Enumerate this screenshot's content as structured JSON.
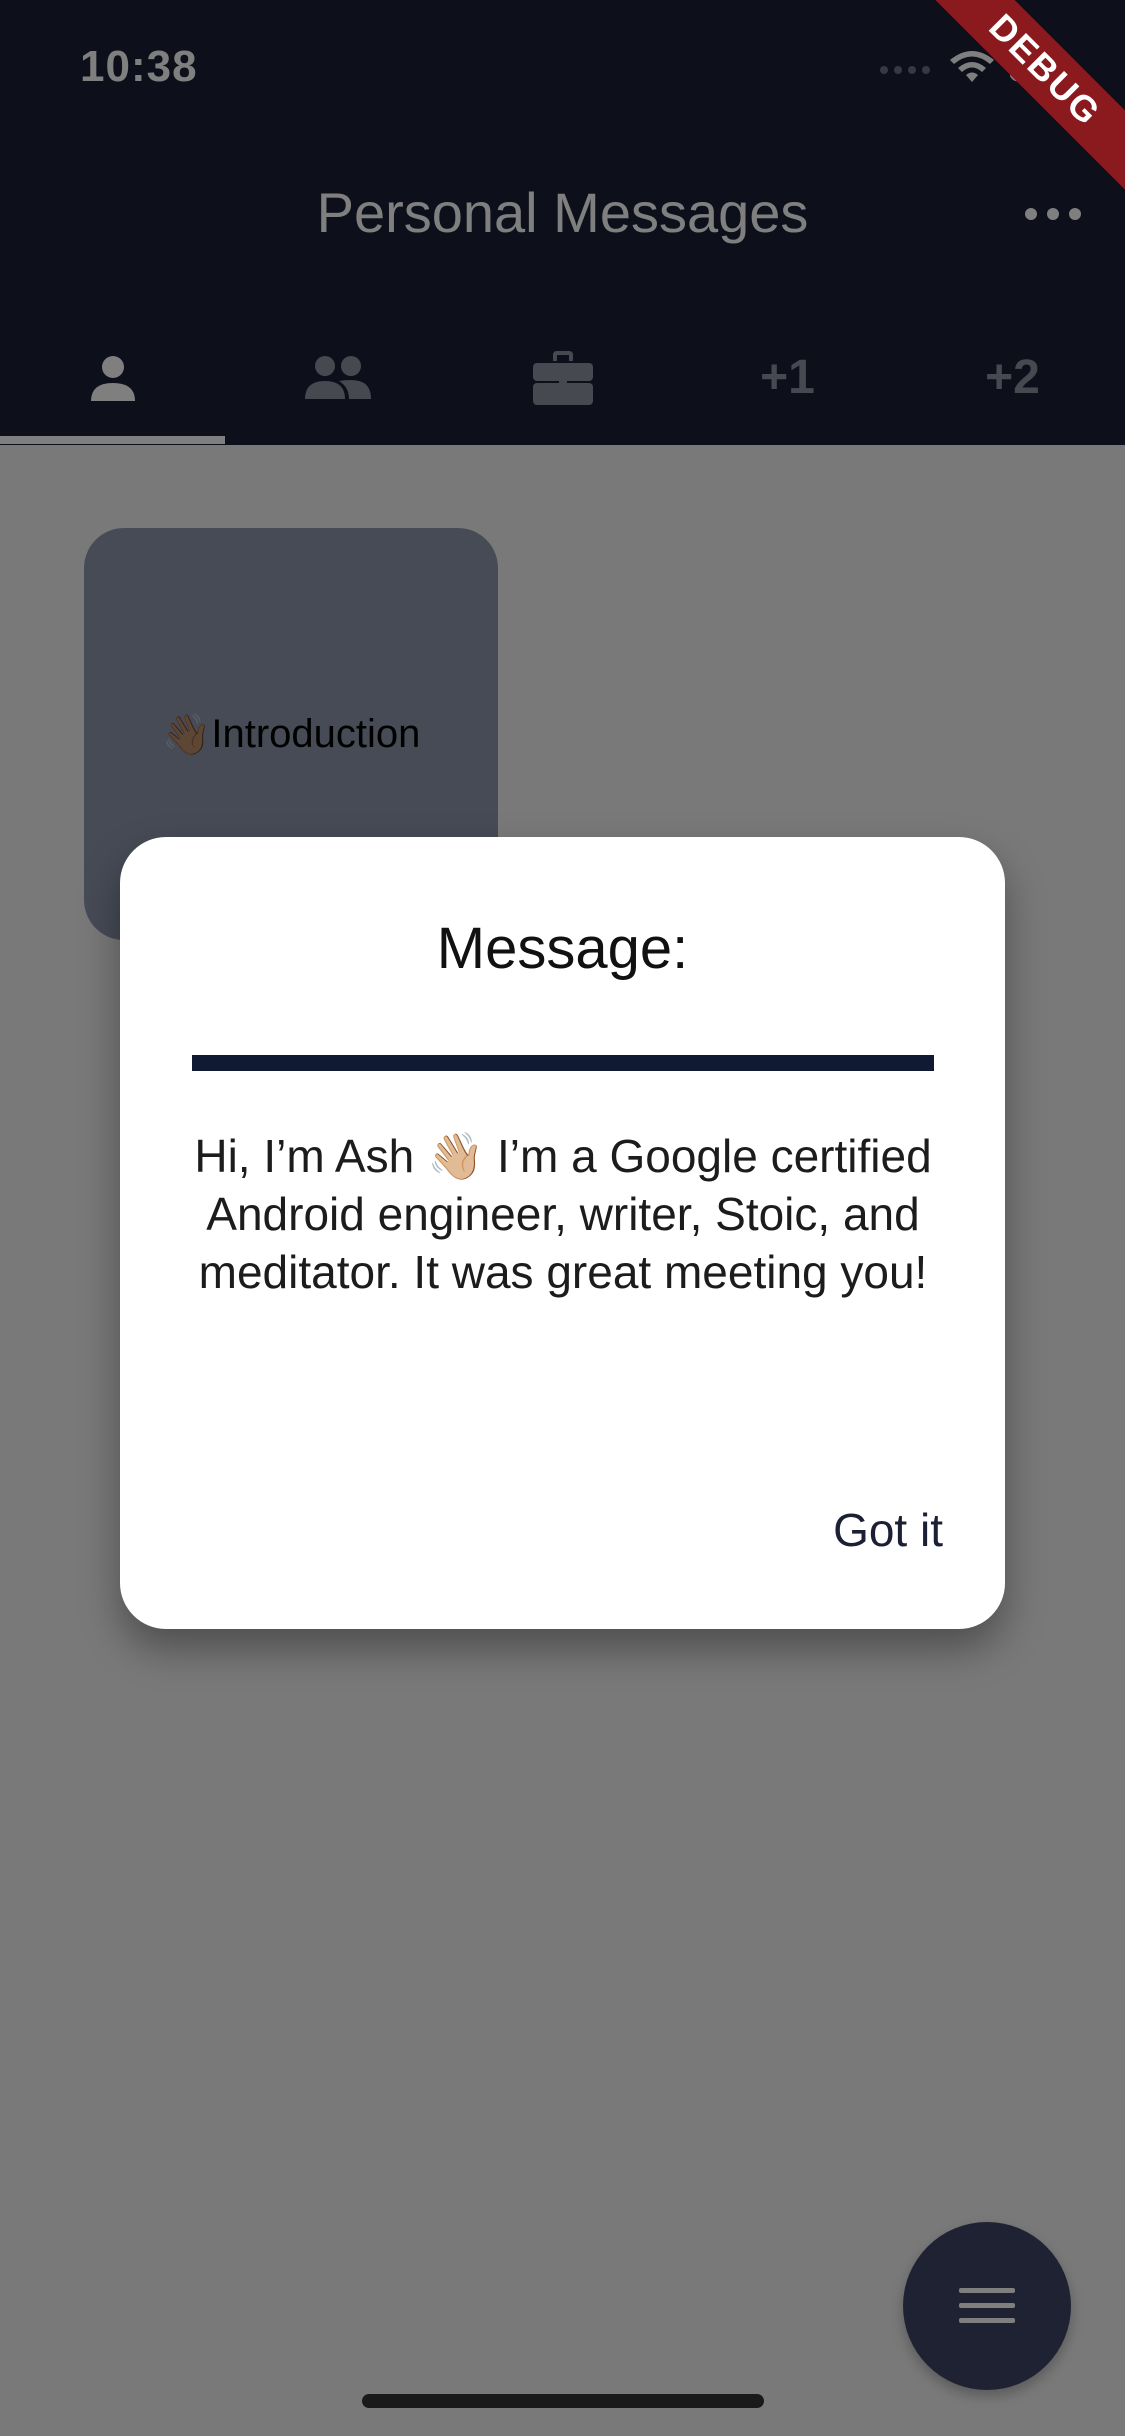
{
  "status_bar": {
    "time": "10:38",
    "debug_label": "DEBUG"
  },
  "app_bar": {
    "title": "Personal Messages",
    "menu_icon": "more-horizontal-icon"
  },
  "tabs": [
    {
      "icon": "person-icon",
      "label": "",
      "active": true
    },
    {
      "icon": "group-icon",
      "label": "",
      "active": false
    },
    {
      "icon": "briefcase-icon",
      "label": "",
      "active": false
    },
    {
      "icon": "",
      "label": "+1",
      "active": false
    },
    {
      "icon": "",
      "label": "+2",
      "active": false
    }
  ],
  "cards": [
    {
      "emoji": "👋🏽",
      "label": "Introduction"
    }
  ],
  "dialog": {
    "title": "Message:",
    "body": "Hi, I’m Ash 👋🏼 I’m a Google certified Android engineer, writer, Stoic, and meditator.  It was great meeting you!",
    "action_label": "Got it"
  },
  "fab": {
    "icon": "menu-icon"
  },
  "colors": {
    "app_bar": "#1b2035",
    "card": "#8d97ad",
    "fab": "#3f4566",
    "divider": "#111a33"
  }
}
